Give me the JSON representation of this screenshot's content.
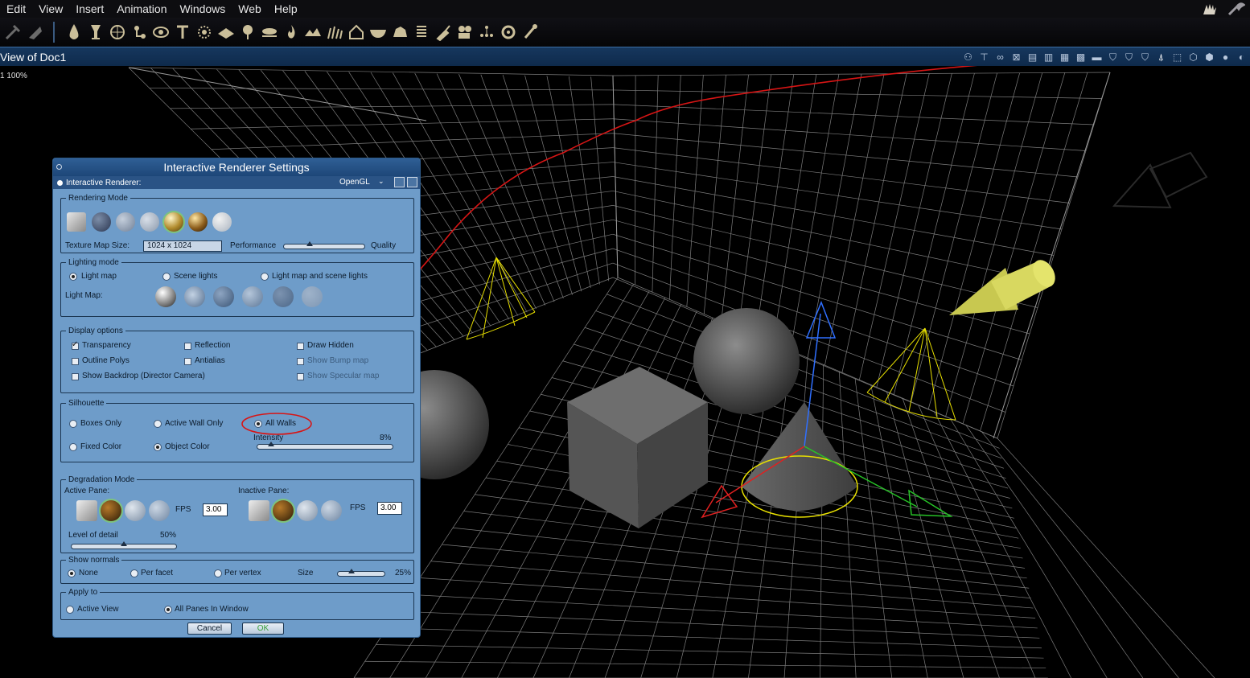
{
  "menubar": {
    "items": [
      "Edit",
      "View",
      "Insert",
      "Animation",
      "Windows",
      "Web",
      "Help"
    ]
  },
  "toolbar": {
    "icons": [
      "modify-tool-icon",
      "magnet-tool-icon",
      "droplet-icon",
      "goblet-icon",
      "sphere-wire-icon",
      "joint-icon",
      "eye-icon",
      "text-icon",
      "particles-icon",
      "plane-icon",
      "tree-icon",
      "cloud-icon",
      "fire-icon",
      "landscape-icon",
      "grass-icon",
      "house-icon",
      "bowl-icon",
      "rock-icon",
      "spring-icon",
      "brush-icon",
      "camera-icon",
      "array-icon",
      "ring-icon",
      "bone-icon"
    ]
  },
  "viewbar": {
    "title": "View of Doc1"
  },
  "viewport": {
    "zoom_label": "1 100%"
  },
  "dialog": {
    "title": "Interactive Renderer Settings",
    "renderer_label": "Interactive Renderer:",
    "renderer_value": "OpenGL",
    "rendering_mode": {
      "legend": "Rendering Mode",
      "texture_label": "Texture Map Size:",
      "texture_value": "1024 x  1024",
      "performance_label": "Performance",
      "quality_label": "Quality",
      "performance_level": 0.3
    },
    "lighting": {
      "legend": "Lighting mode",
      "opt1": "Light map",
      "opt2": "Scene lights",
      "opt3": "Light map and scene lights",
      "lightmap_label": "Light Map:"
    },
    "display": {
      "legend": "Display options",
      "transparency": "Transparency",
      "reflection": "Reflection",
      "draw_hidden": "Draw Hidden",
      "outline_polys": "Outline Polys",
      "antialias": "Antialias",
      "show_bump": "Show Bump map",
      "show_backdrop": "Show Backdrop (Director Camera)",
      "show_specular": "Show Specular map"
    },
    "silhouette": {
      "legend": "Silhouette",
      "boxes_only": "Boxes Only",
      "active_wall_only": "Active Wall Only",
      "all_walls": "All Walls",
      "fixed_color": "Fixed Color",
      "object_color": "Object Color",
      "intensity_label": "Intensity",
      "intensity_value": "8%",
      "intensity_level": 0.08
    },
    "degradation": {
      "legend": "Degradation Mode",
      "active_label": "Active Pane:",
      "inactive_label": "Inactive Pane:",
      "fps_label": "FPS",
      "active_fps": "3.00",
      "inactive_fps": "3.00",
      "lod_label": "Level of detail",
      "lod_value": "50%",
      "lod_level": 0.5
    },
    "normals": {
      "legend": "Show normals",
      "none": "None",
      "per_facet": "Per facet",
      "per_vertex": "Per vertex",
      "size_label": "Size",
      "size_value": "25%",
      "size_level": 0.25
    },
    "apply": {
      "legend": "Apply to",
      "active_view": "Active View",
      "all_panes": "All Panes In Window"
    },
    "cancel_label": "Cancel",
    "ok_label": "OK"
  },
  "colors": {
    "annotation": "#d81515",
    "dialog_bg": "#6e9cc9",
    "title_bar": "#1d4678",
    "grid": "#8a8a8a",
    "light_gizmo": "#e8e000"
  }
}
